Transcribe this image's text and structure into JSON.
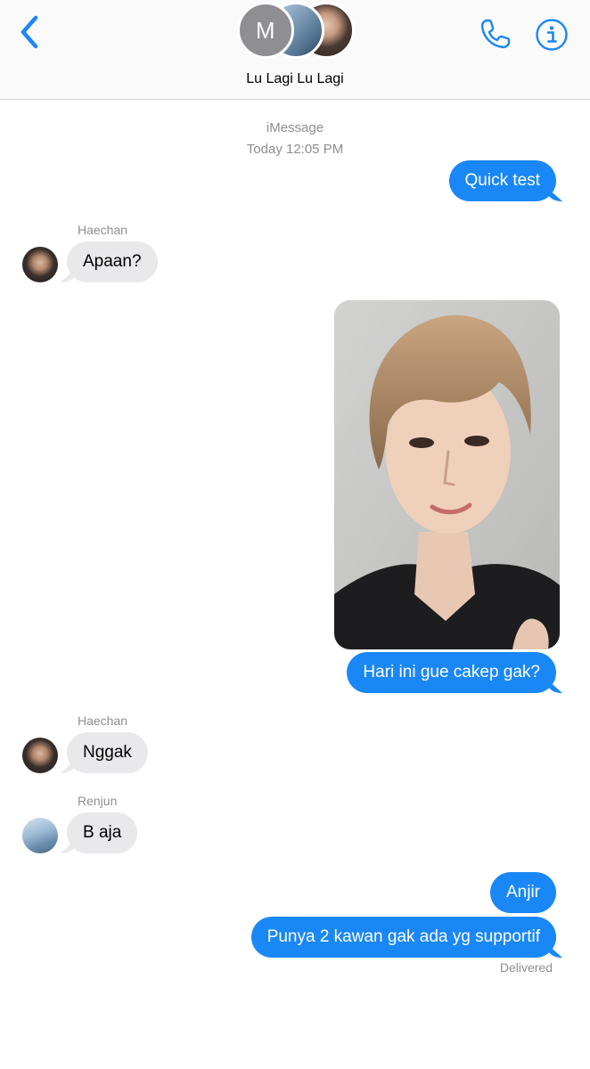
{
  "header": {
    "group_name": "Lu Lagi Lu Lagi",
    "avatar_initial": "M",
    "icons": [
      "chevron-left-icon",
      "phone-icon",
      "info-icon"
    ],
    "accent_color": "#1a87f7"
  },
  "thread": {
    "service": "iMessage",
    "timestamp": "Today 12:05 PM",
    "messages": [
      {
        "direction": "outgoing",
        "text": "Quick test"
      },
      {
        "direction": "incoming",
        "sender": "Haechan",
        "text": "Apaan?"
      },
      {
        "direction": "outgoing",
        "type": "photo",
        "text": ""
      },
      {
        "direction": "outgoing",
        "text": "Hari ini gue cakep gak?"
      },
      {
        "direction": "incoming",
        "sender": "Haechan",
        "text": "Nggak"
      },
      {
        "direction": "incoming",
        "sender": "Renjun",
        "text": "B aja"
      },
      {
        "direction": "outgoing",
        "text": "Anjir"
      },
      {
        "direction": "outgoing",
        "text": "Punya 2 kawan gak ada yg supportif"
      }
    ],
    "status": "Delivered"
  },
  "colors": {
    "outgoing_bubble": "#1a87f7",
    "incoming_bubble": "#e9e9eb",
    "meta_text": "#8e8e93"
  }
}
